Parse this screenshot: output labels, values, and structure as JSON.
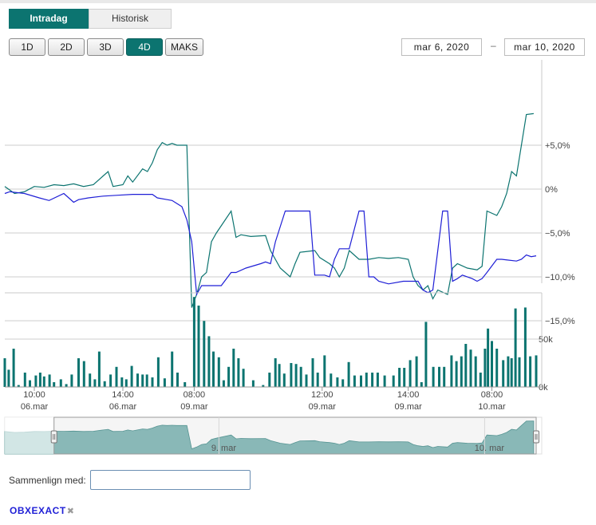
{
  "tabs": [
    {
      "label": "Intradag",
      "active": true
    },
    {
      "label": "Historisk",
      "active": false
    }
  ],
  "ranges": [
    {
      "label": "1D",
      "active": false
    },
    {
      "label": "2D",
      "active": false
    },
    {
      "label": "3D",
      "active": false
    },
    {
      "label": "4D",
      "active": true
    },
    {
      "label": "MAKS",
      "active": false
    }
  ],
  "date_from": "mar 6, 2020",
  "date_separator": "–",
  "date_to": "mar 10, 2020",
  "compare": {
    "label": "Sammenlign med:",
    "value": ""
  },
  "compare_chip": {
    "label": "OBXEXACT",
    "close": "✖"
  },
  "colors": {
    "primary": "#0c7470",
    "compare": "#1f1fd6",
    "volume": "#0c7470",
    "navigator_fill": "#8fc0bf"
  },
  "chart_data": {
    "type": "line",
    "y_axis": {
      "ticks": [
        5,
        0,
        -5,
        -10,
        -15
      ],
      "tick_labels": [
        "+5,0%",
        "0%",
        "−5,0%",
        "−10,0%",
        "−15,0%"
      ],
      "range": [
        -15,
        9
      ]
    },
    "volume_axis": {
      "ticks": [
        50000,
        0
      ],
      "tick_labels": [
        "50k",
        "0k"
      ],
      "range": [
        0,
        90000
      ]
    },
    "x_axis": {
      "range": [
        0,
        108
      ],
      "ticks": [
        {
          "at": 6,
          "time": "10:00",
          "date": "06.mar"
        },
        {
          "at": 24,
          "time": "14:00",
          "date": "06.mar"
        },
        {
          "at": 38.5,
          "time": "08:00",
          "date": "09.mar"
        },
        {
          "at": 64.5,
          "time": "12:00",
          "date": "09.mar"
        },
        {
          "at": 82,
          "time": "14:00",
          "date": "09.mar"
        },
        {
          "at": 99,
          "time": "08:00",
          "date": "10.mar"
        }
      ]
    },
    "series": [
      {
        "color": "#0c7470",
        "points": [
          [
            0,
            0.3
          ],
          [
            2,
            -0.5
          ],
          [
            4,
            -0.3
          ],
          [
            6,
            0.3
          ],
          [
            8,
            0.2
          ],
          [
            10,
            0.5
          ],
          [
            12,
            0.4
          ],
          [
            14,
            0.6
          ],
          [
            16,
            0.3
          ],
          [
            18,
            0.5
          ],
          [
            20,
            1.5
          ],
          [
            21,
            2.0
          ],
          [
            22,
            0.3
          ],
          [
            24,
            0.5
          ],
          [
            25,
            1.5
          ],
          [
            26,
            0.8
          ],
          [
            28,
            2.3
          ],
          [
            29,
            2.0
          ],
          [
            30,
            3.0
          ],
          [
            31,
            4.5
          ],
          [
            32,
            5.3
          ],
          [
            33,
            5.0
          ],
          [
            34,
            5.2
          ],
          [
            35,
            5.0
          ],
          [
            37,
            5.0
          ],
          [
            38,
            -13.5
          ],
          [
            39,
            -12.0
          ],
          [
            40,
            -10.0
          ],
          [
            41,
            -9.5
          ],
          [
            42,
            -6.0
          ],
          [
            43,
            -5.0
          ],
          [
            46,
            -2.5
          ],
          [
            47,
            -5.5
          ],
          [
            48,
            -5.2
          ],
          [
            50,
            -5.4
          ],
          [
            53,
            -5.3
          ],
          [
            54,
            -7.0
          ],
          [
            56,
            -9.0
          ],
          [
            58,
            -10.0
          ],
          [
            59,
            -8.5
          ],
          [
            60,
            -7.2
          ],
          [
            63,
            -7.0
          ],
          [
            64,
            -7.8
          ],
          [
            66,
            -8.5
          ],
          [
            67,
            -9.0
          ],
          [
            68,
            -10.0
          ],
          [
            69,
            -9.0
          ],
          [
            70,
            -7.0
          ],
          [
            72,
            -8.0
          ],
          [
            74,
            -8.0
          ],
          [
            76,
            -7.8
          ],
          [
            78,
            -7.9
          ],
          [
            80,
            -7.8
          ],
          [
            82,
            -8.0
          ],
          [
            83,
            -10.0
          ],
          [
            84,
            -11.0
          ],
          [
            85,
            -11.5
          ],
          [
            86,
            -11.0
          ],
          [
            87,
            -12.5
          ],
          [
            88,
            -11.5
          ],
          [
            90,
            -12.0
          ],
          [
            91,
            -9.0
          ],
          [
            92,
            -8.5
          ],
          [
            94,
            -9.0
          ],
          [
            96,
            -9.2
          ],
          [
            97,
            -8.8
          ],
          [
            98,
            -2.5
          ],
          [
            100,
            -3.0
          ],
          [
            101,
            -2.0
          ],
          [
            102,
            -0.5
          ],
          [
            103,
            2.0
          ],
          [
            104,
            1.5
          ],
          [
            105,
            5.0
          ],
          [
            106,
            8.5
          ],
          [
            107.5,
            8.6
          ]
        ]
      },
      {
        "color": "#1f1fd6",
        "points": [
          [
            0,
            -0.5
          ],
          [
            1,
            -0.3
          ],
          [
            4,
            -0.5
          ],
          [
            7,
            -1.0
          ],
          [
            9,
            -1.3
          ],
          [
            12,
            -0.5
          ],
          [
            14,
            -1.5
          ],
          [
            15,
            -1.2
          ],
          [
            17,
            -1.0
          ],
          [
            20,
            -0.8
          ],
          [
            23,
            -0.7
          ],
          [
            26,
            -0.6
          ],
          [
            28,
            -0.6
          ],
          [
            30,
            -0.6
          ],
          [
            31,
            -1.0
          ],
          [
            33,
            -1.2
          ],
          [
            34,
            -1.3
          ],
          [
            36,
            -2.0
          ],
          [
            37,
            -3.5
          ],
          [
            38,
            -6.0
          ],
          [
            39,
            -12.0
          ],
          [
            40,
            -11.0
          ],
          [
            42,
            -11.0
          ],
          [
            44,
            -11.0
          ],
          [
            46,
            -9.5
          ],
          [
            47,
            -9.5
          ],
          [
            49,
            -9.0
          ],
          [
            52,
            -8.5
          ],
          [
            53,
            -8.3
          ],
          [
            54,
            -8.5
          ],
          [
            55,
            -6.0
          ],
          [
            57,
            -2.5
          ],
          [
            60,
            -2.5
          ],
          [
            62,
            -2.5
          ],
          [
            63,
            -9.8
          ],
          [
            65,
            -9.8
          ],
          [
            66,
            -10.0
          ],
          [
            67,
            -8.0
          ],
          [
            68,
            -6.8
          ],
          [
            70,
            -6.8
          ],
          [
            72,
            -2.5
          ],
          [
            73,
            -2.5
          ],
          [
            74,
            -10.0
          ],
          [
            75,
            -10.0
          ],
          [
            76,
            -10.5
          ],
          [
            78,
            -10.8
          ],
          [
            81,
            -10.5
          ],
          [
            83,
            -10.5
          ],
          [
            84,
            -10.5
          ],
          [
            85,
            -11.5
          ],
          [
            86,
            -11.8
          ],
          [
            87,
            -11.5
          ],
          [
            88,
            -7.0
          ],
          [
            89,
            -2.5
          ],
          [
            90,
            -2.5
          ],
          [
            91,
            -10.5
          ],
          [
            92,
            -10.2
          ],
          [
            93,
            -9.8
          ],
          [
            95,
            -10.2
          ],
          [
            96,
            -10.5
          ],
          [
            97,
            -10.2
          ],
          [
            98,
            -9.5
          ],
          [
            100,
            -8.0
          ],
          [
            101,
            -8.0
          ],
          [
            104,
            -8.2
          ],
          [
            105,
            -8.0
          ],
          [
            106,
            -7.5
          ],
          [
            107,
            -7.7
          ],
          [
            108,
            -7.6
          ]
        ]
      }
    ],
    "volume": [
      [
        0,
        30000
      ],
      [
        0.8,
        18000
      ],
      [
        1.8,
        40000
      ],
      [
        2.8,
        2000
      ],
      [
        4.1,
        15000
      ],
      [
        5.1,
        7000
      ],
      [
        6.3,
        12000
      ],
      [
        7.2,
        15000
      ],
      [
        8,
        11000
      ],
      [
        9.1,
        13000
      ],
      [
        10,
        5000
      ],
      [
        11.4,
        8000
      ],
      [
        12.5,
        3000
      ],
      [
        13.6,
        13000
      ],
      [
        15,
        30000
      ],
      [
        16.1,
        27000
      ],
      [
        17.3,
        14000
      ],
      [
        18.3,
        8000
      ],
      [
        19.2,
        37000
      ],
      [
        20.3,
        6000
      ],
      [
        21.5,
        13000
      ],
      [
        22.7,
        21000
      ],
      [
        23.8,
        10000
      ],
      [
        24.7,
        8000
      ],
      [
        25.8,
        22000
      ],
      [
        27,
        14000
      ],
      [
        28,
        13000
      ],
      [
        28.9,
        13000
      ],
      [
        30,
        10000
      ],
      [
        31.2,
        31000
      ],
      [
        32.5,
        9000
      ],
      [
        34,
        37000
      ],
      [
        35.1,
        15000
      ],
      [
        36.6,
        5000
      ],
      [
        38.5,
        94000
      ],
      [
        39.4,
        85000
      ],
      [
        40.5,
        69000
      ],
      [
        41.5,
        53000
      ],
      [
        42.4,
        37000
      ],
      [
        43.5,
        31000
      ],
      [
        44.5,
        7000
      ],
      [
        45.5,
        21000
      ],
      [
        46.5,
        40000
      ],
      [
        47.5,
        30000
      ],
      [
        48.5,
        19000
      ],
      [
        50.5,
        7000
      ],
      [
        52.5,
        2000
      ],
      [
        53.8,
        15000
      ],
      [
        55,
        30000
      ],
      [
        55.8,
        24000
      ],
      [
        56.8,
        14000
      ],
      [
        58.2,
        25000
      ],
      [
        59.2,
        24000
      ],
      [
        60.2,
        21000
      ],
      [
        61.3,
        13000
      ],
      [
        62.6,
        30000
      ],
      [
        63.6,
        15000
      ],
      [
        65,
        33000
      ],
      [
        66.3,
        14000
      ],
      [
        67.6,
        10000
      ],
      [
        68.7,
        8000
      ],
      [
        69.9,
        26000
      ],
      [
        71.1,
        12000
      ],
      [
        72.4,
        12000
      ],
      [
        73.5,
        15000
      ],
      [
        74.7,
        15000
      ],
      [
        75.8,
        15000
      ],
      [
        77.2,
        12000
      ],
      [
        79,
        12000
      ],
      [
        80.2,
        20000
      ],
      [
        81.2,
        20000
      ],
      [
        82.4,
        28000
      ],
      [
        83.7,
        32000
      ],
      [
        84.7,
        5000
      ],
      [
        85.6,
        68000
      ],
      [
        87.1,
        21000
      ],
      [
        88.3,
        21000
      ],
      [
        89.3,
        21000
      ],
      [
        90.8,
        33000
      ],
      [
        91.8,
        27000
      ],
      [
        92.8,
        32000
      ],
      [
        93.7,
        45000
      ],
      [
        94.7,
        39000
      ],
      [
        95.7,
        32000
      ],
      [
        96.7,
        15000
      ],
      [
        97.6,
        40000
      ],
      [
        98.2,
        61000
      ],
      [
        99,
        48000
      ],
      [
        100,
        40000
      ],
      [
        101.3,
        28000
      ],
      [
        102.3,
        32000
      ],
      [
        103,
        30000
      ],
      [
        103.8,
        82000
      ],
      [
        104.6,
        31000
      ],
      [
        105.8,
        83000
      ],
      [
        106.8,
        32000
      ],
      [
        108,
        33000
      ]
    ],
    "navigator": {
      "labels": [
        {
          "at": 44.5,
          "text": "9. mar"
        },
        {
          "at": 98.5,
          "text": "10. mar"
        }
      ],
      "selection": [
        10,
        108
      ]
    }
  }
}
